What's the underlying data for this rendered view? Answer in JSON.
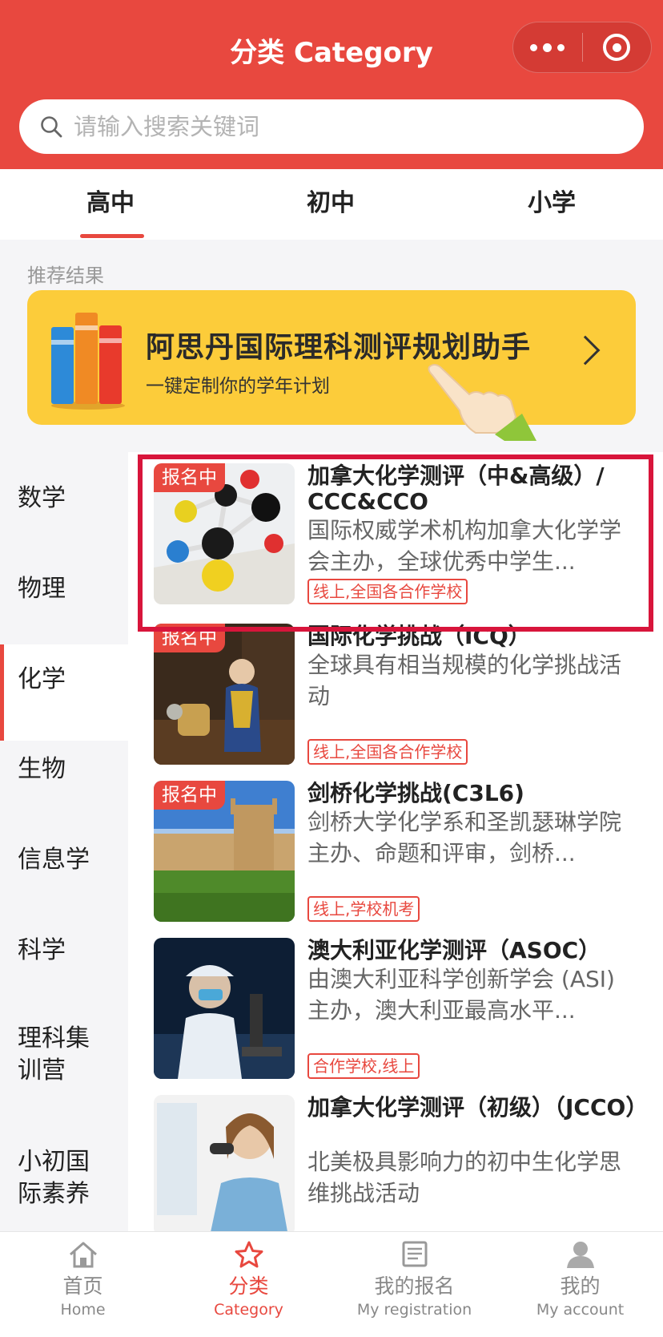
{
  "header": {
    "title": "分类 Category"
  },
  "search": {
    "placeholder": "请输入搜索关键词"
  },
  "tabs": [
    {
      "label": "高中",
      "active": true
    },
    {
      "label": "初中",
      "active": false
    },
    {
      "label": "小学",
      "active": false
    }
  ],
  "recommend": {
    "label": "推荐结果",
    "banner_title": "阿思丹国际理科测评规划助手",
    "banner_subtitle": "一键定制你的学年计划"
  },
  "sidebar": {
    "items": [
      {
        "label": "数学"
      },
      {
        "label": "物理"
      },
      {
        "label": "化学",
        "active": true
      },
      {
        "label": "生物"
      },
      {
        "label": "信息学"
      },
      {
        "label": "科学"
      },
      {
        "label": "理科集训营"
      },
      {
        "label": "小初国际素养"
      }
    ]
  },
  "list": {
    "items": [
      {
        "badge": "报名中",
        "title": "加拿大化学测评（中&高级）/ CCC&CCO",
        "desc": "国际权威学术机构加拿大化学学会主办，全球优秀中学生...",
        "tag": "线上,全国各合作学校"
      },
      {
        "badge": "报名中",
        "title": "国际化学挑战（ICQ）",
        "desc": "全球具有相当规模的化学挑战活动",
        "tag": "线上,全国各合作学校"
      },
      {
        "badge": "报名中",
        "title": "剑桥化学挑战(C3L6)",
        "desc": "剑桥大学化学系和圣凯瑟琳学院主办、命题和评审，剑桥...",
        "tag": "线上,学校机考"
      },
      {
        "badge": "",
        "title": "澳大利亚化学测评（ASOC）",
        "desc": "由澳大利亚科学创新学会 (ASI) 主办，澳大利亚最高水平...",
        "tag": "合作学校,线上"
      },
      {
        "badge": "",
        "title": "加拿大化学测评（初级）（JCCO）",
        "desc": "北美极具影响力的初中生化学思维挑战活动",
        "tag": ""
      }
    ]
  },
  "bottom_nav": [
    {
      "zh": "首页",
      "en": "Home",
      "icon": "home-icon"
    },
    {
      "zh": "分类",
      "en": "Category",
      "icon": "star-icon",
      "active": true
    },
    {
      "zh": "我的报名",
      "en": "My registration",
      "icon": "registration-icon"
    },
    {
      "zh": "我的",
      "en": "My account",
      "icon": "user-icon"
    }
  ],
  "colors": {
    "brand": "#e8483f",
    "banner": "#fccc3a",
    "highlight": "#d8153b"
  }
}
